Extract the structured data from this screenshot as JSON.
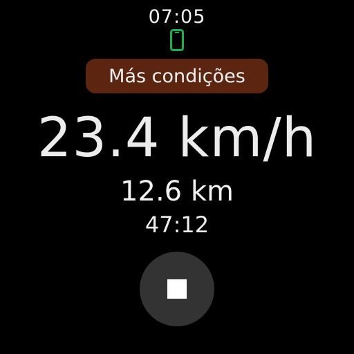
{
  "status_bar": {
    "time": "07:05",
    "phone_icon": "phone-connected-icon",
    "phone_icon_color": "#1ab04a"
  },
  "condition": {
    "label": "Más condições",
    "background": "#5c2510"
  },
  "metrics": {
    "speed": "23.4 km/h",
    "distance": "12.6 km",
    "duration": "47:12"
  },
  "controls": {
    "stop_icon": "stop-icon",
    "stop_button_color": "#333333"
  }
}
